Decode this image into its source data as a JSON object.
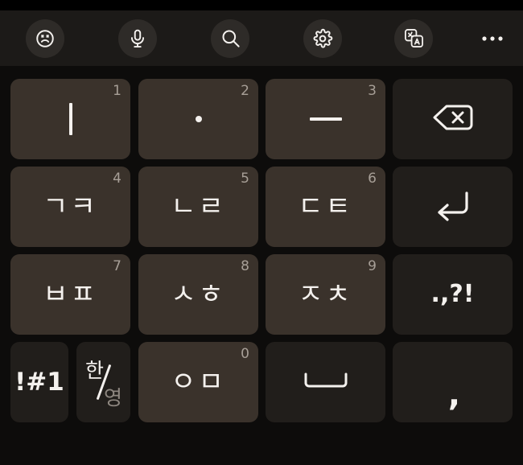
{
  "colors": {
    "background": "#000000",
    "toolbar_bg": "#1c1a18",
    "keyboard_bg": "#0d0c0b",
    "char_key": "#3a322b",
    "function_key": "#211e1b",
    "key_text": "#f4f1ee",
    "key_number": "#a79f97",
    "inactive_text": "#8e8780"
  },
  "toolbar": {
    "items": [
      {
        "name": "emoji-button",
        "icon": "sad-face-icon",
        "label": "Emoji"
      },
      {
        "name": "voice-input-button",
        "icon": "microphone-icon",
        "label": "Voice input"
      },
      {
        "name": "search-button",
        "icon": "search-icon",
        "label": "Search"
      },
      {
        "name": "settings-button",
        "icon": "gear-icon",
        "label": "Settings"
      },
      {
        "name": "translate-button",
        "icon": "translate-icon",
        "label": "Translate"
      },
      {
        "name": "more-options-button",
        "icon": "overflow-menu-icon",
        "label": "More options"
      }
    ]
  },
  "keyboard": {
    "layout_name": "Korean Cheonjiin (naratgeul) 12-key",
    "rows": [
      [
        {
          "id": "key-1",
          "label": "ー",
          "glyph": "vertical-bar",
          "number": "1",
          "type": "char"
        },
        {
          "id": "key-2",
          "label": "·",
          "glyph": "dot",
          "number": "2",
          "type": "char"
        },
        {
          "id": "key-3",
          "label": "—",
          "glyph": "dash",
          "number": "3",
          "type": "char"
        },
        {
          "id": "key-backspace",
          "label": "",
          "glyph": "backspace-icon",
          "number": "",
          "type": "function"
        }
      ],
      [
        {
          "id": "key-4",
          "label": "ㄱㅋ",
          "glyph": "text",
          "number": "4",
          "type": "char"
        },
        {
          "id": "key-5",
          "label": "ㄴㄹ",
          "glyph": "text",
          "number": "5",
          "type": "char"
        },
        {
          "id": "key-6",
          "label": "ㄷㅌ",
          "glyph": "text",
          "number": "6",
          "type": "char"
        },
        {
          "id": "key-enter",
          "label": "",
          "glyph": "enter-icon",
          "number": "",
          "type": "function"
        }
      ],
      [
        {
          "id": "key-7",
          "label": "ㅂㅍ",
          "glyph": "text",
          "number": "7",
          "type": "char"
        },
        {
          "id": "key-8",
          "label": "ㅅㅎ",
          "glyph": "text",
          "number": "8",
          "type": "char"
        },
        {
          "id": "key-9",
          "label": "ㅈㅊ",
          "glyph": "text",
          "number": "9",
          "type": "char"
        },
        {
          "id": "key-punctuation",
          "label": ".,?!",
          "glyph": "text",
          "number": "",
          "type": "function"
        }
      ],
      [
        {
          "id": "key-symbols",
          "label": "!#1",
          "glyph": "text",
          "number": "",
          "type": "function"
        },
        {
          "id": "key-language-toggle",
          "label": "한/영",
          "glyph": "lang-split",
          "number": "",
          "type": "function",
          "active_label": "한",
          "inactive_label": "영"
        },
        {
          "id": "key-0",
          "label": "ㅇㅁ",
          "glyph": "text",
          "number": "0",
          "type": "char"
        },
        {
          "id": "key-space",
          "label": "",
          "glyph": "space-icon",
          "number": "",
          "type": "function"
        },
        {
          "id": "key-comma",
          "label": ",",
          "glyph": "text",
          "number": "",
          "type": "function"
        }
      ]
    ]
  }
}
